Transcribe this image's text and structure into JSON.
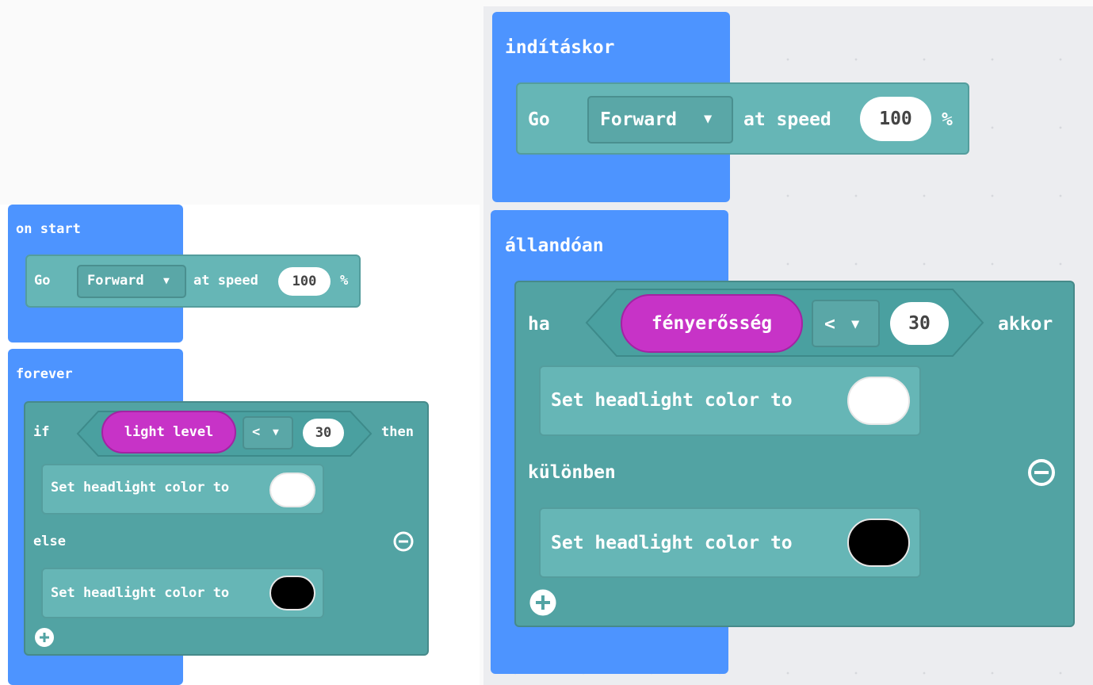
{
  "left": {
    "on_start": {
      "title": "on start",
      "go": "Go",
      "direction": "Forward",
      "at_speed": "at speed",
      "speed": "100",
      "percent": "%"
    },
    "forever": {
      "title": "forever",
      "if_label": "if",
      "sensor": "light level",
      "operator": "<",
      "threshold": "30",
      "then_label": "then",
      "set_headlight_1": "Set headlight color to",
      "else_label": "else",
      "set_headlight_2": "Set headlight color to"
    }
  },
  "right": {
    "on_start": {
      "title": "indításkor",
      "go": "Go",
      "direction": "Forward",
      "at_speed": "at speed",
      "speed": "100",
      "percent": "%"
    },
    "forever": {
      "title": "állandóan",
      "if_label": "ha",
      "sensor": "fényerősség",
      "operator": "<",
      "threshold": "30",
      "then_label": "akkor",
      "set_headlight_1": "Set headlight color to",
      "else_label": "különben",
      "set_headlight_2": "Set headlight color to"
    }
  },
  "colors": {
    "event_block": "#4d94ff",
    "motor_block": "#66b6b6",
    "logic_block": "#52a3a3",
    "sensor_block": "#c733c7",
    "headlight_on": "#ffffff",
    "headlight_off": "#000000"
  },
  "icons": {
    "dropdown": "caret-down-icon",
    "remove_else": "minus-circle-icon",
    "add_else": "plus-circle-icon"
  }
}
